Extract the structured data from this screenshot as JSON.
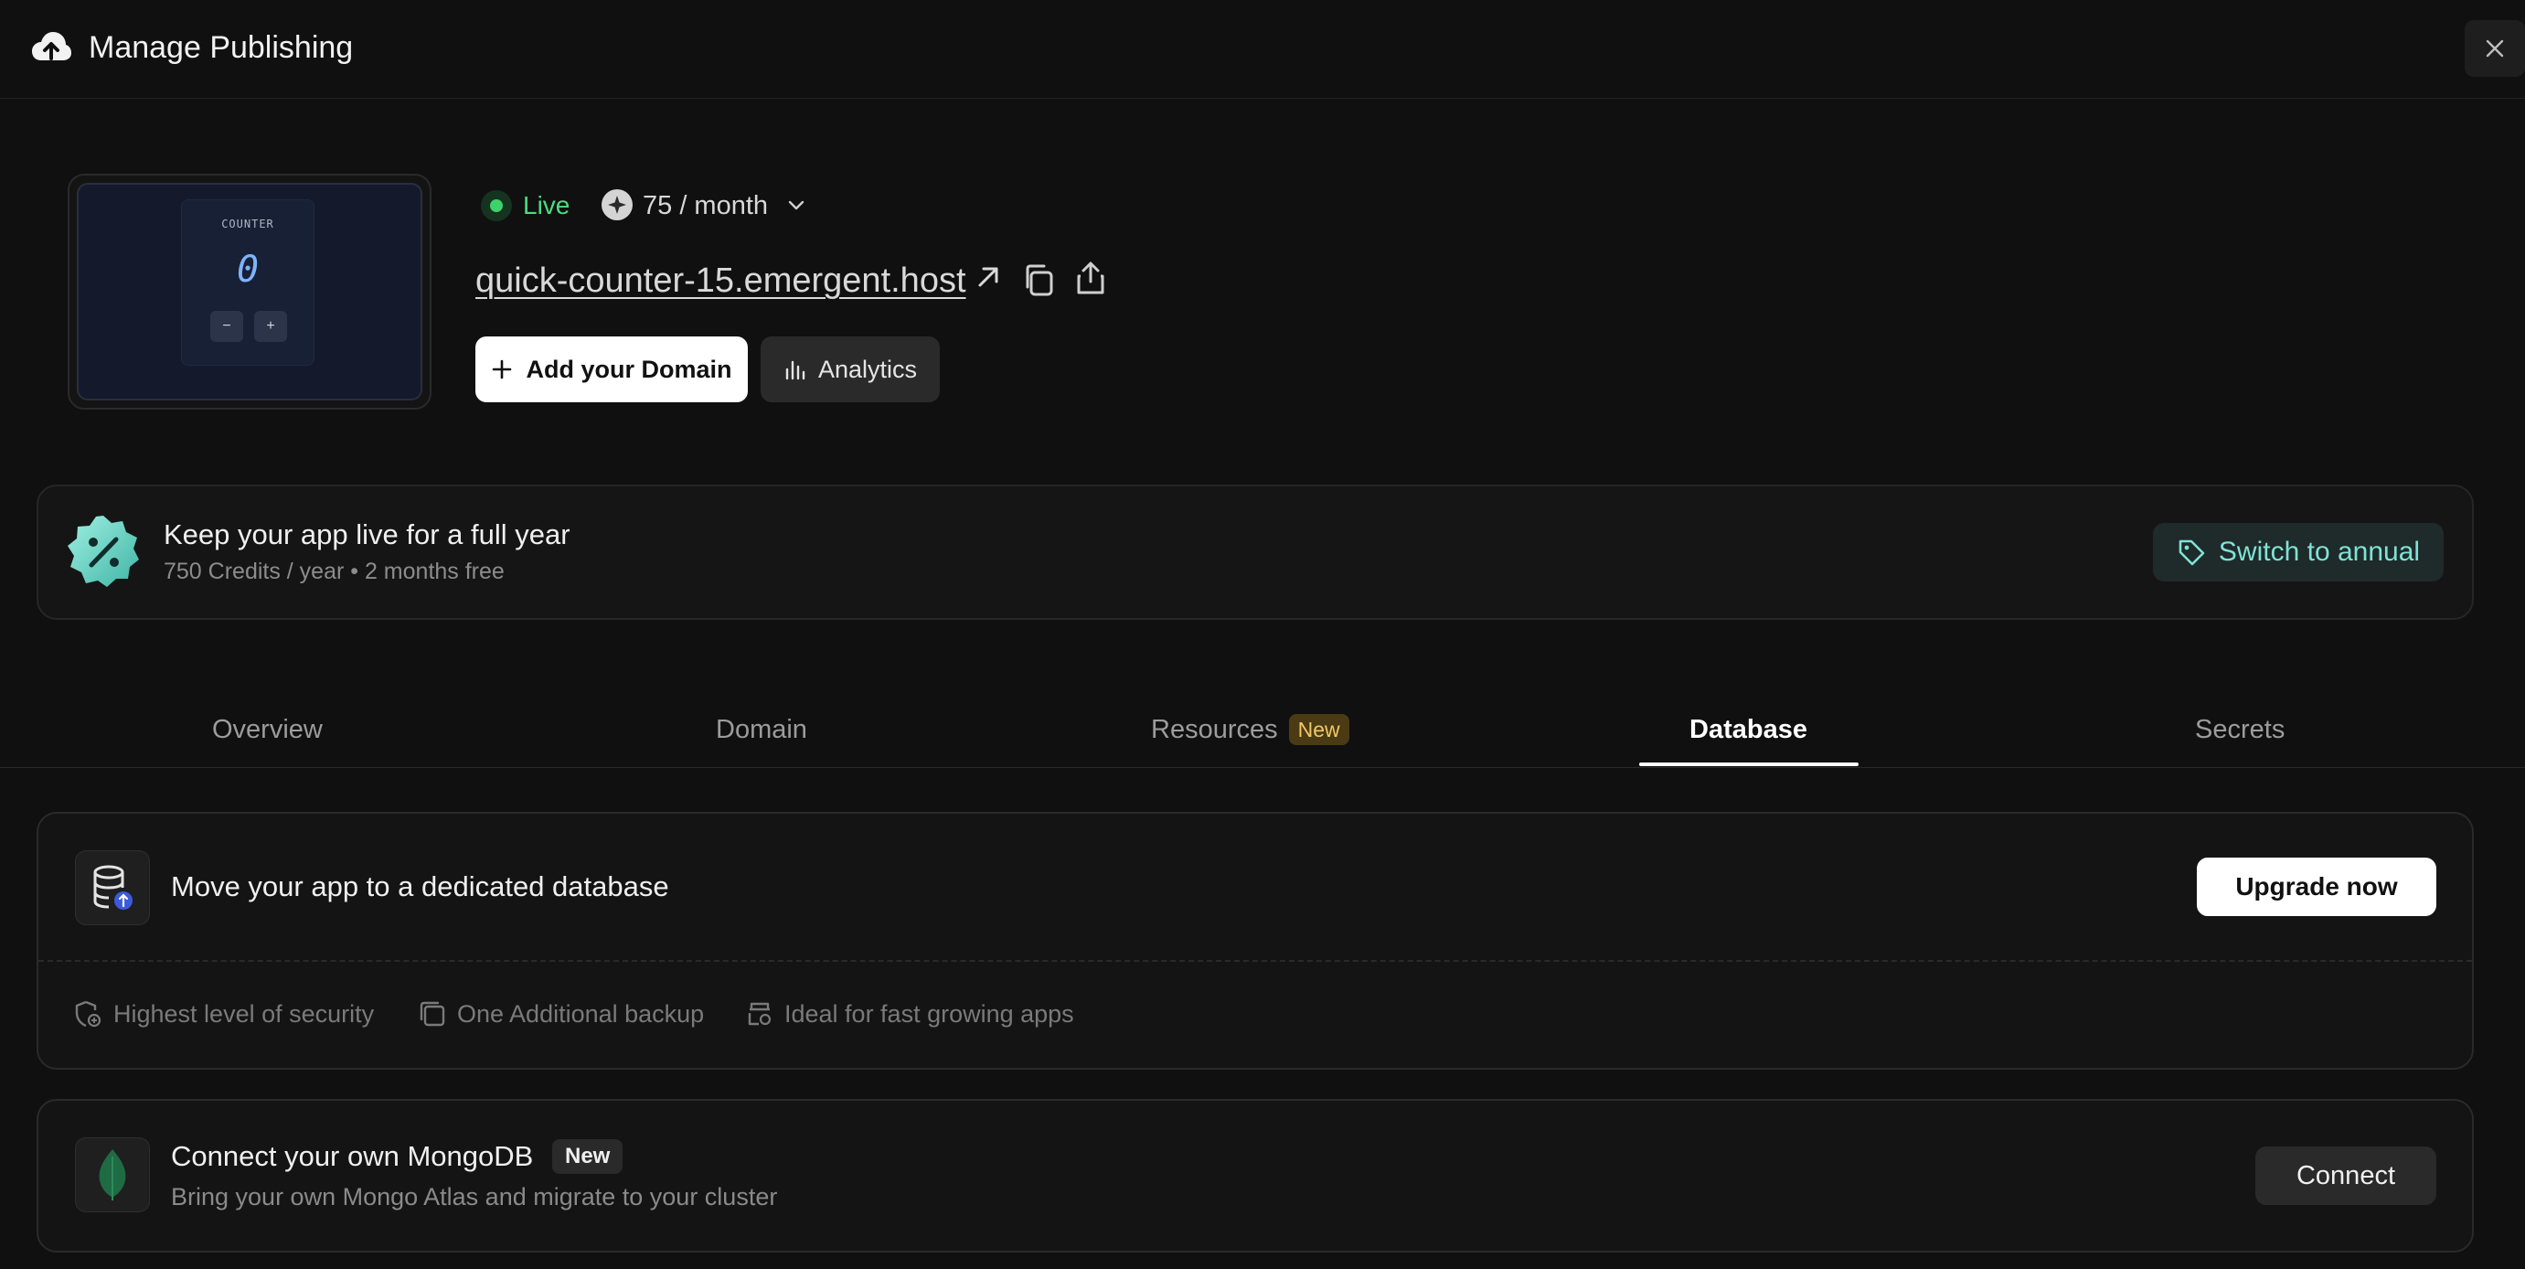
{
  "header": {
    "title": "Manage Publishing",
    "icon": "cloud-upload-icon",
    "close_icon": "close-icon"
  },
  "preview": {
    "label": "COUNTER",
    "count": "0",
    "minus": "−",
    "plus": "+"
  },
  "status": {
    "live_label": "Live",
    "live_color": "#4ade80",
    "price": "75 / month"
  },
  "url": {
    "text": "quick-counter-15.emergent.host"
  },
  "actions": {
    "add_domain": "Add your Domain",
    "analytics": "Analytics"
  },
  "banner": {
    "title": "Keep your app live for a full year",
    "subtitle": "750 Credits / year • 2 months free",
    "button": "Switch to annual",
    "accent": "#7fe3d4"
  },
  "tabs": [
    {
      "label": "Overview",
      "active": false
    },
    {
      "label": "Domain",
      "active": false
    },
    {
      "label": "Resources",
      "badge": "New",
      "active": false
    },
    {
      "label": "Database",
      "active": true
    },
    {
      "label": "Secrets",
      "active": false
    }
  ],
  "database_card": {
    "title": "Move your app to a dedicated database",
    "button": "Upgrade now",
    "features": [
      {
        "icon": "shield-icon",
        "label": "Highest level of security"
      },
      {
        "icon": "backup-icon",
        "label": "One Additional backup"
      },
      {
        "icon": "growth-icon",
        "label": "Ideal for fast growing apps"
      }
    ]
  },
  "mongo_card": {
    "title": "Connect your own MongoDB",
    "badge": "New",
    "subtitle": "Bring your own Mongo Atlas and migrate to your cluster",
    "button": "Connect"
  }
}
